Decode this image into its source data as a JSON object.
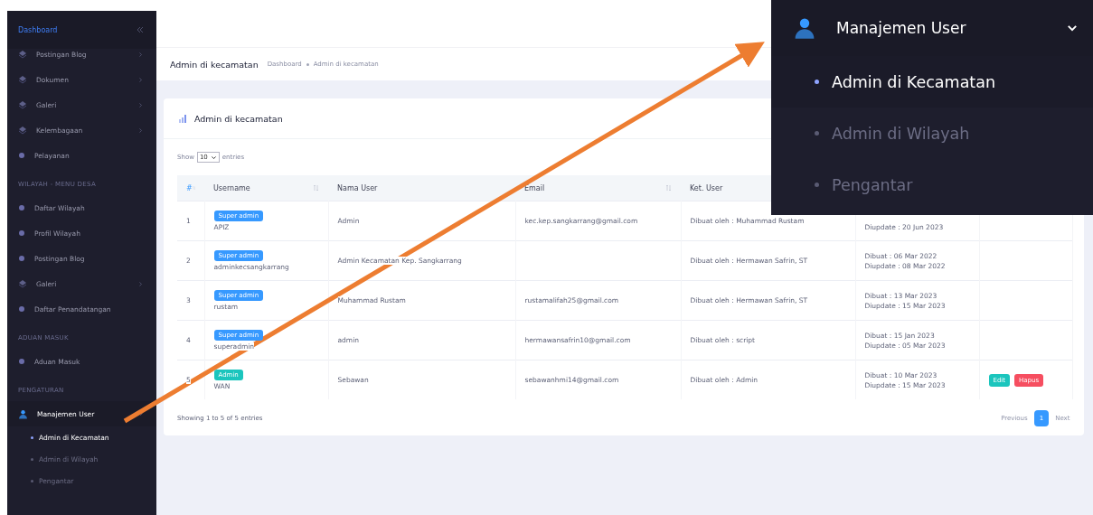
{
  "sidebar": {
    "brand": "Dashboard",
    "sections": [
      {
        "items": [
          {
            "label": "Postingan Blog",
            "kind": "group",
            "expanded": false
          },
          {
            "label": "Dokumen",
            "kind": "group",
            "expanded": false
          },
          {
            "label": "Galeri",
            "kind": "group",
            "expanded": false
          },
          {
            "label": "Kelembagaan",
            "kind": "group",
            "expanded": false
          },
          {
            "label": "Pelayanan",
            "kind": "link"
          }
        ]
      },
      {
        "heading": "WILAYAH - MENU DESA",
        "items": [
          {
            "label": "Daftar Wilayah",
            "kind": "link"
          },
          {
            "label": "Profil Wilayah",
            "kind": "link"
          },
          {
            "label": "Postingan Blog",
            "kind": "link"
          },
          {
            "label": "Galeri",
            "kind": "group",
            "expanded": false
          },
          {
            "label": "Daftar Penandatangan",
            "kind": "link"
          }
        ]
      },
      {
        "heading": "ADUAN MASUK",
        "items": [
          {
            "label": "Aduan Masuk",
            "kind": "link"
          }
        ]
      },
      {
        "heading": "PENGATURAN",
        "items": [
          {
            "label": "Manajemen User",
            "kind": "user",
            "expanded": true,
            "children": [
              {
                "label": "Admin di Kecamatan",
                "selected": true
              },
              {
                "label": "Admin di Wilayah",
                "selected": false
              },
              {
                "label": "Pengantar",
                "selected": false
              }
            ]
          }
        ]
      }
    ]
  },
  "page_header": {
    "title": "Admin di kecamatan",
    "breadcrumb": [
      "Dashboard",
      "Admin di kecamatan"
    ]
  },
  "card": {
    "title": "Admin di kecamatan",
    "show_label": "Show",
    "page_size": "10",
    "entries_label": "entries",
    "columns": [
      "#",
      "Username",
      "Nama User",
      "Email",
      "Ket. User"
    ],
    "rows": [
      {
        "no": "1",
        "role": {
          "label": "Super admin",
          "kind": "super"
        },
        "username": "APIZ",
        "name": "Admin",
        "email": "kec.kep.sangkarrang@gmail.com",
        "note": "Dibuat oleh : Muhammad Rustam",
        "dates": [
          "Diupdate : 20 Jun 2023"
        ]
      },
      {
        "no": "2",
        "role": {
          "label": "Super admin",
          "kind": "super"
        },
        "username": "adminkecsangkarrang",
        "name": "Admin Kecamatan Kep. Sangkarrang",
        "note": "Dibuat oleh : Hermawan Safrin, ST",
        "dates": [
          "Dibuat : 06 Mar 2022",
          "Diupdate : 08 Mar 2022"
        ]
      },
      {
        "no": "3",
        "role": {
          "label": "Super admin",
          "kind": "super"
        },
        "username": "rustam",
        "name": "Muhammad Rustam",
        "email": "rustamalifah25@gmail.com",
        "note": "Dibuat oleh : Hermawan Safrin, ST",
        "dates": [
          "Dibuat : 13 Mar 2023",
          "Diupdate : 15 Mar 2023"
        ]
      },
      {
        "no": "4",
        "role": {
          "label": "Super admin",
          "kind": "super"
        },
        "username": "superadmin",
        "name": "admin",
        "email": "hermawansafrin10@gmail.com",
        "note": "Dibuat oleh : script",
        "dates": [
          "Dibuat : 15 Jan 2023",
          "Diupdate : 05 Mar 2023"
        ]
      },
      {
        "no": "5",
        "role": {
          "label": "Admin",
          "kind": "admin"
        },
        "username": "WAN",
        "name": "Sebawan",
        "email": "sebawanhmi14@gmail.com",
        "note": "Dibuat oleh : Admin",
        "dates": [
          "Dibuat : 10 Mar 2023",
          "Diupdate : 15 Mar 2023"
        ],
        "actions": [
          {
            "label": "Edit",
            "kind": "edit"
          },
          {
            "label": "Hapus",
            "kind": "delete"
          }
        ]
      }
    ],
    "info": "Showing 1 to 5 of 5 entries",
    "pagination": [
      {
        "label": "Previous",
        "kind": "nav"
      },
      {
        "label": "1",
        "kind": "page",
        "selected": true
      },
      {
        "label": "Next",
        "kind": "nav"
      }
    ]
  },
  "callout": {
    "label": "Manajemen User",
    "expanded": true,
    "items": [
      {
        "label": "Admin di Kecamatan",
        "selected": true
      },
      {
        "label": "Admin di Wilayah",
        "selected": false
      },
      {
        "label": "Pengantar",
        "selected": false
      }
    ]
  }
}
